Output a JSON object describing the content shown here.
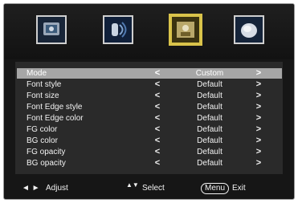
{
  "tabs": [
    {
      "icon": "picture-icon",
      "label": ""
    },
    {
      "icon": "sound-icon",
      "label": ""
    },
    {
      "icon": "options-icon",
      "label": "",
      "selected": true
    },
    {
      "icon": "lock-icon",
      "label": ""
    }
  ],
  "menu": {
    "rows": [
      {
        "label": "Mode",
        "value": "Custom",
        "selected": true
      },
      {
        "label": "Font style",
        "value": "Default"
      },
      {
        "label": "Font size",
        "value": "Default"
      },
      {
        "label": "Font Edge style",
        "value": "Default"
      },
      {
        "label": "Font Edge color",
        "value": "Default"
      },
      {
        "label": "FG color",
        "value": "Default"
      },
      {
        "label": "BG color",
        "value": "Default"
      },
      {
        "label": "FG opacity",
        "value": "Default"
      },
      {
        "label": "BG opacity",
        "value": "Default"
      }
    ]
  },
  "footer": {
    "adjust_arrows": "◄ ►",
    "adjust_label": "Adjust",
    "select_arrows": "▲▼",
    "select_label": "Select",
    "menu_key": "Menu",
    "exit_label": "Exit"
  },
  "colors": {
    "selected_row": "#a6a6a6",
    "panel": "#2a2a2a",
    "frame": "#161616",
    "selected_tab_border": "#d9c34a"
  }
}
